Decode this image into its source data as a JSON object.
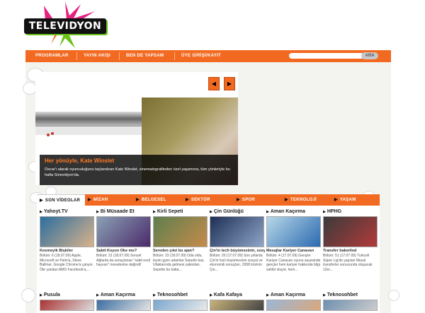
{
  "brand": {
    "logo_text": "TELEVIDYON",
    "burst_colors": [
      "#e6217f",
      "#6bc21b",
      "#f26a21"
    ]
  },
  "nav": {
    "items": [
      "PROGRAMLAR",
      "YAYIN AKIŞI",
      "BEN DE YAPSAM",
      "ÜYE GİRİŞİ/KAYIT"
    ],
    "search_placeholder": "",
    "search_button": "ARA"
  },
  "feature": {
    "title": "Her yönüyle, Kate Winslet",
    "description": "Oscar'ı alarak oyunculuğunu taçlandıran Kate Winslet, sinematografiinden özel yaşamına, tüm yönleriyle bu hafta Sinevidyon'da.",
    "prev_icon": "◀",
    "next_icon": "▶"
  },
  "categories": {
    "tabs": [
      "SON VİDEOLAR",
      "MİZAH",
      "BELGESEL",
      "SEKTÖR",
      "SPOR",
      "TEKNOLOJİ",
      "YAŞAM"
    ],
    "active": "SON VİDEOLAR"
  },
  "cards_row1": [
    {
      "title": "Yahoyt.TV",
      "headline": "Kesmeyik Bişkiler",
      "body": "Bölüm: 6 (18.07.09) Apple, Microsoft ve Palm'a, Steve Ballmer, Google Chrome'a çatıyor. Öte yandan AMD Facebook'a,...",
      "thumb_colors": [
        "#2b6e9e",
        "#d9b28c"
      ]
    },
    {
      "title": "Bi Müsaade Et",
      "headline": "Sabit Koyun Oke mu?",
      "body": "Bölüm: 31 (18.07.09) Sonyel Ağlarda da sonuçlanan \"sabit evcil hayvan\" meselesine değindi!",
      "thumb_colors": [
        "#8aa0b5",
        "#4b2a6a"
      ]
    },
    {
      "title": "Kirli Sepeti",
      "headline": "Sereden çıkıt bu ajan?",
      "body": "Bölüm: 23 (18.07.09) Oda oldu, teyim gyen adamlar Sepetle bas. Ufaklarında gelmesi yakindan. Sepette bu katta...",
      "thumb_colors": [
        "#5e7f4f",
        "#c68b4a"
      ]
    },
    {
      "title": "Çin Günlüğü",
      "headline": "Çin'in tech büyümesinin, sosyal ve ekonomik sonuçları",
      "body": "Bölüm: 20 (17.07.09) Son yıllarda Çin'in hızlı büyümesinin sosyal ve ekonomik sonuçları, 2008 krizinin Çin...",
      "thumb_colors": [
        "#1d2f55",
        "#8fa6c9"
      ]
    },
    {
      "title": "Aman Kaçırma",
      "headline": "Mesajlar Kariyer Canavarı",
      "body": "Bölüm: 4 (17.07.09) Gençler Kariyer Canavarı oyunu sayesinde gençler hem kariyer hakkında bilgi sahibi oluyor, hem...",
      "thumb_colors": [
        "#b7d7e8",
        "#2b6ab0"
      ]
    },
    {
      "title": "HPHG",
      "headline": "Transfer bakeriled",
      "body": "Bölüm: 51 (17.07.09) Turkcell Süper Lig'de yapılan Meyal transferler sonucunda oluşacak 12er...",
      "thumb_colors": [
        "#3b3b3b",
        "#b23a3a"
      ]
    }
  ],
  "cards_row2": [
    {
      "title": "Pusula",
      "thumb_colors": [
        "#a33",
        "#ddd"
      ]
    },
    {
      "title": "Aman Kaçırma",
      "thumb_colors": [
        "#3c6ea3",
        "#e3e3e3"
      ]
    },
    {
      "title": "Teknosohbet",
      "thumb_colors": [
        "#7aa7cf",
        "#e9e9e9"
      ]
    },
    {
      "title": "Kafa Kafaya",
      "thumb_colors": [
        "#c9b27a",
        "#444"
      ]
    },
    {
      "title": "Aman Kaçırma",
      "thumb_colors": [
        "#9bb7d8",
        "#d9a87c"
      ]
    },
    {
      "title": "Teknosohbet",
      "thumb_colors": [
        "#6d8fb0",
        "#ccc"
      ]
    }
  ]
}
